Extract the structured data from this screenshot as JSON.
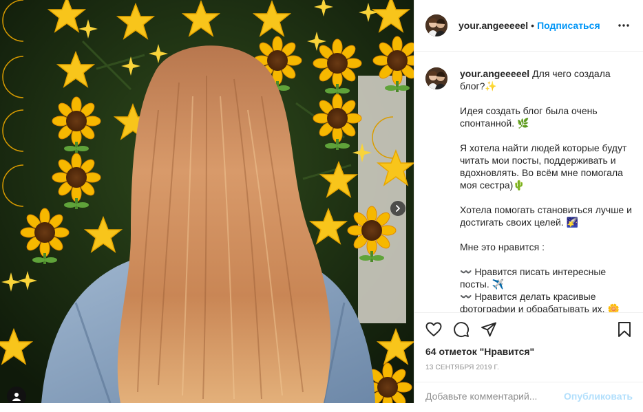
{
  "post": {
    "username": "your.angeeeeel",
    "dot": "•",
    "follow_label": "Подписаться",
    "caption": [
      "Для чего создала блог?✨",
      "Идея создать блог была очень спонтанной. 🌿",
      "Я хотела найти людей которые будут читать мои посты, поддерживать и вдохновлять. Во всём мне помогала моя сестра)🌵",
      "Хотела помогать становиться лучше и достигать своих целей. 🌠",
      "Мне это нравится :",
      "〰️ Нравится писать интересные посты. ✈️",
      "〰️ Нравится делать красивые фотографии и обрабатывать их. 🌼"
    ],
    "likes_label": "64 отметок \"Нравится\"",
    "date": "13 сентября 2019 г.",
    "comment_placeholder": "Добавьте комментарий...",
    "publish_label": "Опубликовать"
  },
  "icons": {
    "like": "heart-icon",
    "comment": "comment-icon",
    "share": "share-icon",
    "save": "bookmark-icon",
    "more": "more-icon",
    "next": "chevron-right-icon",
    "tags": "user-tag-icon"
  },
  "colors": {
    "accent": "#0095f6",
    "publish_disabled": "#b2dffc",
    "muted": "#8e8e8e"
  }
}
